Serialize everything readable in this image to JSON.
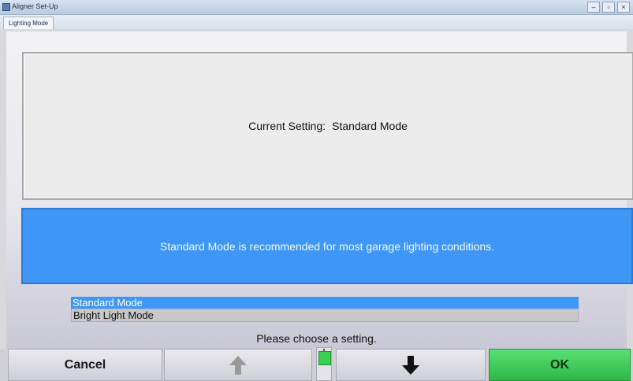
{
  "window": {
    "title": "Aligner Set-Up",
    "tab": "Lighting Mode",
    "controls": [
      "–",
      "▫",
      "×"
    ]
  },
  "current": {
    "label": "Current Setting:",
    "value": "Standard Mode"
  },
  "info": {
    "text": "Standard Mode is recommended for most garage lighting conditions."
  },
  "options": {
    "items": [
      {
        "label": "Standard Mode",
        "selected": true
      },
      {
        "label": "Bright Light Mode",
        "selected": false
      }
    ]
  },
  "prompt": "Please choose a setting.",
  "toolbar": {
    "cancel_label": "Cancel",
    "up_icon": "up-arrow-icon",
    "down_icon": "down-arrow-icon",
    "ok_label": "OK"
  },
  "scroll": {
    "position_fraction": 0.1
  },
  "colors": {
    "accent_blue": "#3e97f6",
    "ok_green": "#38d14f"
  }
}
